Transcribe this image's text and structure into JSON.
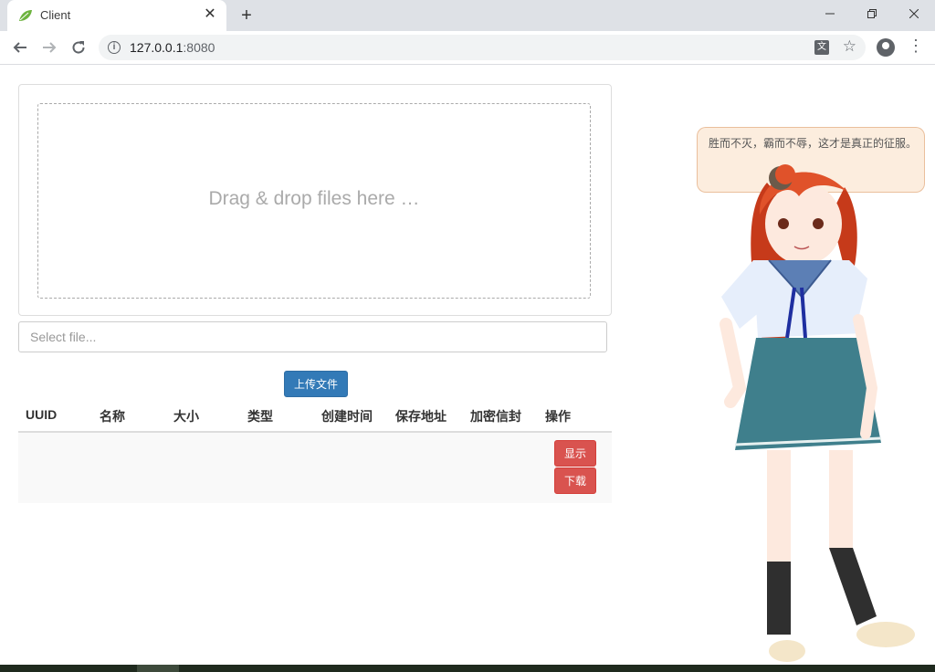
{
  "browser": {
    "tab_title": "Client",
    "url_host": "127.0.0.1",
    "url_port": ":8080",
    "new_tab": "+",
    "close": "✕",
    "icons": [
      "leaf-icon",
      "close-icon",
      "plus-icon",
      "minimize-icon",
      "maximize-icon",
      "window-close-icon",
      "back-icon",
      "forward-icon",
      "reload-icon",
      "info-icon",
      "translate-icon",
      "star-icon",
      "profile-icon",
      "menu-icon"
    ]
  },
  "upload": {
    "drop_text": "Drag & drop files here …",
    "select_placeholder": "Select file...",
    "upload_label": "上传文件"
  },
  "table": {
    "headers": [
      "UUID",
      "名称",
      "大小",
      "类型",
      "创建时间",
      "保存地址",
      "加密信封",
      "操作"
    ],
    "rows": [
      {
        "show_label": "显示",
        "download_label": "下载"
      }
    ]
  },
  "mascot": {
    "speech": "胜而不灭，霸而不辱，这才是真正的征服。"
  },
  "colors": {
    "primary": "#337ab7",
    "danger": "#d9534f",
    "chrome": "#dee1e6"
  }
}
